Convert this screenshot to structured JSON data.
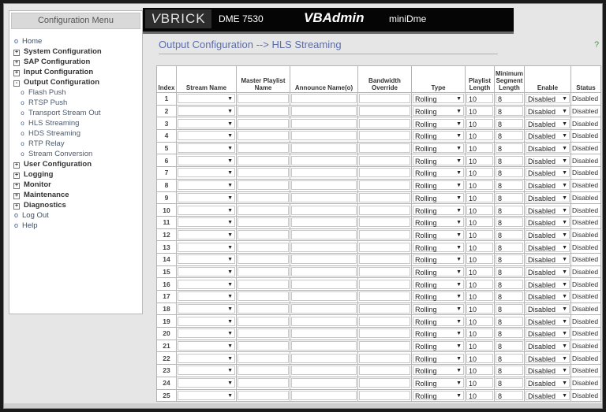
{
  "sidebar": {
    "title": "Configuration Menu",
    "items": [
      {
        "label": "Home",
        "kind": "plain",
        "marker": "o"
      },
      {
        "label": "System Configuration",
        "kind": "box",
        "marker": "+"
      },
      {
        "label": "SAP Configuration",
        "kind": "box",
        "marker": "+"
      },
      {
        "label": "Input Configuration",
        "kind": "box",
        "marker": "+"
      },
      {
        "label": "Output Configuration",
        "kind": "box",
        "marker": "-"
      },
      {
        "label": "Flash Push",
        "kind": "sub",
        "marker": "o"
      },
      {
        "label": "RTSP Push",
        "kind": "sub",
        "marker": "o"
      },
      {
        "label": "Transport Stream Out",
        "kind": "sub",
        "marker": "o"
      },
      {
        "label": "HLS Streaming",
        "kind": "sub",
        "marker": "o"
      },
      {
        "label": "HDS Streaming",
        "kind": "sub",
        "marker": "o"
      },
      {
        "label": "RTP Relay",
        "kind": "sub",
        "marker": "o"
      },
      {
        "label": "Stream Conversion",
        "kind": "sub",
        "marker": "o"
      },
      {
        "label": "User Configuration",
        "kind": "box",
        "marker": "+"
      },
      {
        "label": "Logging",
        "kind": "box",
        "marker": "+"
      },
      {
        "label": "Monitor",
        "kind": "box",
        "marker": "+"
      },
      {
        "label": "Maintenance",
        "kind": "box",
        "marker": "+"
      },
      {
        "label": "Diagnostics",
        "kind": "box",
        "marker": "+"
      },
      {
        "label": "Log Out",
        "kind": "plain",
        "marker": "o"
      },
      {
        "label": "Help",
        "kind": "plain",
        "marker": "o"
      }
    ]
  },
  "banner": {
    "logo_v": "V",
    "logo_rest": "BRICK",
    "model": "DME 7530",
    "app_title": "VBAdmin",
    "device_name": "miniDme"
  },
  "main": {
    "page_title": "Output Configuration --> HLS Streaming",
    "help_label": "?"
  },
  "table": {
    "headers": {
      "index": "Index",
      "stream_name": "Stream Name",
      "master_playlist": "Master Playlist Name",
      "announce_name": "Announce Name(o)",
      "bandwidth_override": "Bandwidth Override",
      "type": "Type",
      "playlist_length": "Playlist Length",
      "min_segment_length": "Minimum Segment Length",
      "enable": "Enable",
      "status": "Status"
    },
    "row_defaults": {
      "stream_name": "",
      "master_playlist": "",
      "announce_name": "",
      "bandwidth_override": "",
      "type": "Rolling",
      "playlist_length": "10",
      "min_segment_length": "8",
      "enable": "Disabled",
      "status": "Disabled"
    },
    "rows": [
      {
        "index": "1"
      },
      {
        "index": "2"
      },
      {
        "index": "3"
      },
      {
        "index": "4"
      },
      {
        "index": "5"
      },
      {
        "index": "6"
      },
      {
        "index": "7"
      },
      {
        "index": "8"
      },
      {
        "index": "9"
      },
      {
        "index": "10"
      },
      {
        "index": "11"
      },
      {
        "index": "12"
      },
      {
        "index": "13"
      },
      {
        "index": "14"
      },
      {
        "index": "15"
      },
      {
        "index": "16"
      },
      {
        "index": "17"
      },
      {
        "index": "18"
      },
      {
        "index": "19"
      },
      {
        "index": "20"
      },
      {
        "index": "21"
      },
      {
        "index": "22"
      },
      {
        "index": "23"
      },
      {
        "index": "24"
      },
      {
        "index": "25"
      }
    ]
  },
  "icons": {
    "dropdown": "chevron-down-icon",
    "expand": "plus-box-icon",
    "collapse": "minus-box-icon",
    "bullet": "bullet-icon"
  },
  "colors": {
    "banner_bg": "#050505",
    "title_blue": "#5b6ea8",
    "help_green": "#4a9a4a"
  }
}
